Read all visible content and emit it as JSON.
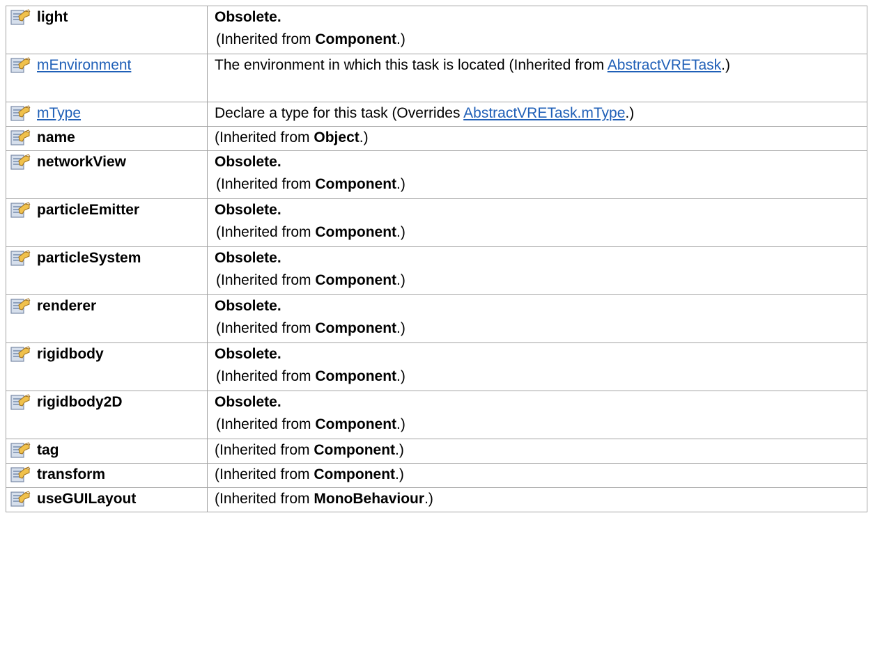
{
  "rows": [
    {
      "name": "light",
      "name_is_link": false,
      "obsolete": "Obsolete.",
      "desc": "",
      "inherit_prefix": "(Inherited from ",
      "inherit_from": "Component",
      "inherit_is_link": false,
      "inherit_suffix": ".)"
    },
    {
      "name": "mEnvironment",
      "name_is_link": true,
      "obsolete": "",
      "desc": "The environment in which this task is located (Inherited from ",
      "inherit_prefix": "",
      "inherit_from": "AbstractVRETask",
      "inherit_is_link": true,
      "inherit_suffix": ".)"
    },
    {
      "name": "mType",
      "name_is_link": true,
      "obsolete": "",
      "desc": "Declare a type for this task (Overrides ",
      "inherit_prefix": "",
      "inherit_from": "AbstractVRETask.mType",
      "inherit_is_link": true,
      "inherit_suffix": ".)"
    },
    {
      "name": "name",
      "name_is_link": false,
      "obsolete": "",
      "desc": "",
      "inherit_prefix": "(Inherited from ",
      "inherit_from": "Object",
      "inherit_is_link": false,
      "inherit_suffix": ".)"
    },
    {
      "name": "networkView",
      "name_is_link": false,
      "obsolete": "Obsolete.",
      "desc": "",
      "inherit_prefix": "(Inherited from ",
      "inherit_from": "Component",
      "inherit_is_link": false,
      "inherit_suffix": ".)"
    },
    {
      "name": "particleEmitter",
      "name_is_link": false,
      "obsolete": "Obsolete.",
      "desc": "",
      "inherit_prefix": "(Inherited from ",
      "inherit_from": "Component",
      "inherit_is_link": false,
      "inherit_suffix": ".)"
    },
    {
      "name": "particleSystem",
      "name_is_link": false,
      "obsolete": "Obsolete.",
      "desc": "",
      "inherit_prefix": "(Inherited from ",
      "inherit_from": "Component",
      "inherit_is_link": false,
      "inherit_suffix": ".)"
    },
    {
      "name": "renderer",
      "name_is_link": false,
      "obsolete": "Obsolete.",
      "desc": "",
      "inherit_prefix": "(Inherited from ",
      "inherit_from": "Component",
      "inherit_is_link": false,
      "inherit_suffix": ".)"
    },
    {
      "name": "rigidbody",
      "name_is_link": false,
      "obsolete": "Obsolete.",
      "desc": "",
      "inherit_prefix": "(Inherited from ",
      "inherit_from": "Component",
      "inherit_is_link": false,
      "inherit_suffix": ".)"
    },
    {
      "name": "rigidbody2D",
      "name_is_link": false,
      "obsolete": "Obsolete.",
      "desc": "",
      "inherit_prefix": "(Inherited from ",
      "inherit_from": "Component",
      "inherit_is_link": false,
      "inherit_suffix": ".)"
    },
    {
      "name": "tag",
      "name_is_link": false,
      "obsolete": "",
      "desc": "",
      "inherit_prefix": "(Inherited from ",
      "inherit_from": "Component",
      "inherit_is_link": false,
      "inherit_suffix": ".)"
    },
    {
      "name": "transform",
      "name_is_link": false,
      "obsolete": "",
      "desc": "",
      "inherit_prefix": "(Inherited from ",
      "inherit_from": "Component",
      "inherit_is_link": false,
      "inherit_suffix": ".)"
    },
    {
      "name": "useGUILayout",
      "name_is_link": false,
      "obsolete": "",
      "desc": "",
      "inherit_prefix": "(Inherited from ",
      "inherit_from": "MonoBehaviour",
      "inherit_is_link": false,
      "inherit_suffix": ".)"
    }
  ],
  "icon": "property-icon",
  "colors": {
    "link": "#1f5fb7",
    "border": "#a3a3a3",
    "icon_hand": "#e8b23a",
    "icon_sheet": "#cfd8e6"
  }
}
